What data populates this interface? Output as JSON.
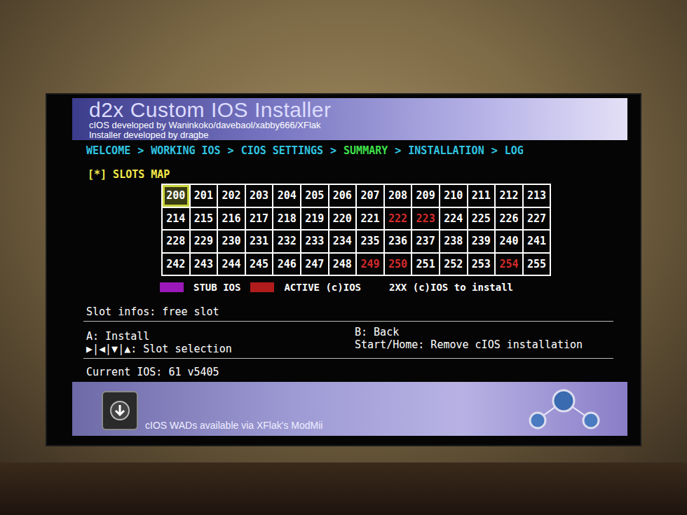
{
  "header": {
    "title": "d2x Custom IOS Installer",
    "credits": [
      "cIOS developed by Waninkoko/davebaol/xabby666/XFlak",
      "Installer developed by dragbe"
    ]
  },
  "breadcrumb": {
    "separator": ">",
    "items": [
      {
        "label": "WELCOME",
        "selected": false
      },
      {
        "label": "WORKING IOS",
        "selected": false
      },
      {
        "label": "CIOS SETTINGS",
        "selected": false
      },
      {
        "label": "SUMMARY",
        "selected": true
      },
      {
        "label": "INSTALLATION",
        "selected": false
      },
      {
        "label": "LOG",
        "selected": false
      }
    ]
  },
  "slots_map": {
    "title": "[*] SLOTS MAP",
    "slots": [
      {
        "label": "200",
        "active": false,
        "selected": true
      },
      {
        "label": "201",
        "active": false,
        "selected": false
      },
      {
        "label": "202",
        "active": false,
        "selected": false
      },
      {
        "label": "203",
        "active": false,
        "selected": false
      },
      {
        "label": "204",
        "active": false,
        "selected": false
      },
      {
        "label": "205",
        "active": false,
        "selected": false
      },
      {
        "label": "206",
        "active": false,
        "selected": false
      },
      {
        "label": "207",
        "active": false,
        "selected": false
      },
      {
        "label": "208",
        "active": false,
        "selected": false
      },
      {
        "label": "209",
        "active": false,
        "selected": false
      },
      {
        "label": "210",
        "active": false,
        "selected": false
      },
      {
        "label": "211",
        "active": false,
        "selected": false
      },
      {
        "label": "212",
        "active": false,
        "selected": false
      },
      {
        "label": "213",
        "active": false,
        "selected": false
      },
      {
        "label": "214",
        "active": false,
        "selected": false
      },
      {
        "label": "215",
        "active": false,
        "selected": false
      },
      {
        "label": "216",
        "active": false,
        "selected": false
      },
      {
        "label": "217",
        "active": false,
        "selected": false
      },
      {
        "label": "218",
        "active": false,
        "selected": false
      },
      {
        "label": "219",
        "active": false,
        "selected": false
      },
      {
        "label": "220",
        "active": false,
        "selected": false
      },
      {
        "label": "221",
        "active": false,
        "selected": false
      },
      {
        "label": "222",
        "active": true,
        "selected": false
      },
      {
        "label": "223",
        "active": true,
        "selected": false
      },
      {
        "label": "224",
        "active": false,
        "selected": false
      },
      {
        "label": "225",
        "active": false,
        "selected": false
      },
      {
        "label": "226",
        "active": false,
        "selected": false
      },
      {
        "label": "227",
        "active": false,
        "selected": false
      },
      {
        "label": "228",
        "active": false,
        "selected": false
      },
      {
        "label": "229",
        "active": false,
        "selected": false
      },
      {
        "label": "230",
        "active": false,
        "selected": false
      },
      {
        "label": "231",
        "active": false,
        "selected": false
      },
      {
        "label": "232",
        "active": false,
        "selected": false
      },
      {
        "label": "233",
        "active": false,
        "selected": false
      },
      {
        "label": "234",
        "active": false,
        "selected": false
      },
      {
        "label": "235",
        "active": false,
        "selected": false
      },
      {
        "label": "236",
        "active": false,
        "selected": false
      },
      {
        "label": "237",
        "active": false,
        "selected": false
      },
      {
        "label": "238",
        "active": false,
        "selected": false
      },
      {
        "label": "239",
        "active": false,
        "selected": false
      },
      {
        "label": "240",
        "active": false,
        "selected": false
      },
      {
        "label": "241",
        "active": false,
        "selected": false
      },
      {
        "label": "242",
        "active": false,
        "selected": false
      },
      {
        "label": "243",
        "active": false,
        "selected": false
      },
      {
        "label": "244",
        "active": false,
        "selected": false
      },
      {
        "label": "245",
        "active": false,
        "selected": false
      },
      {
        "label": "246",
        "active": false,
        "selected": false
      },
      {
        "label": "247",
        "active": false,
        "selected": false
      },
      {
        "label": "248",
        "active": false,
        "selected": false
      },
      {
        "label": "249",
        "active": true,
        "selected": false
      },
      {
        "label": "250",
        "active": true,
        "selected": false
      },
      {
        "label": "251",
        "active": false,
        "selected": false
      },
      {
        "label": "252",
        "active": false,
        "selected": false
      },
      {
        "label": "253",
        "active": false,
        "selected": false
      },
      {
        "label": "254",
        "active": true,
        "selected": false
      },
      {
        "label": "255",
        "active": false,
        "selected": false
      }
    ]
  },
  "legend": [
    {
      "label": "STUB IOS",
      "kind": "swatch",
      "color": "#9a18b8"
    },
    {
      "label": "ACTIVE (c)IOS",
      "kind": "swatch",
      "color": "#b01c1c"
    },
    {
      "label": "2XX (c)IOS to install",
      "kind": "plain"
    }
  ],
  "slot_info": "Slot infos: free slot",
  "controls": {
    "left": [
      "A: Install",
      "▶|◀|▼|▲: Slot selection"
    ],
    "right": [
      "B: Back",
      "Start/Home: Remove cIOS installation"
    ]
  },
  "current_ios": "Current IOS: 61 v5405",
  "footer": {
    "text": "cIOS WADs available via XFlak's ModMii"
  }
}
